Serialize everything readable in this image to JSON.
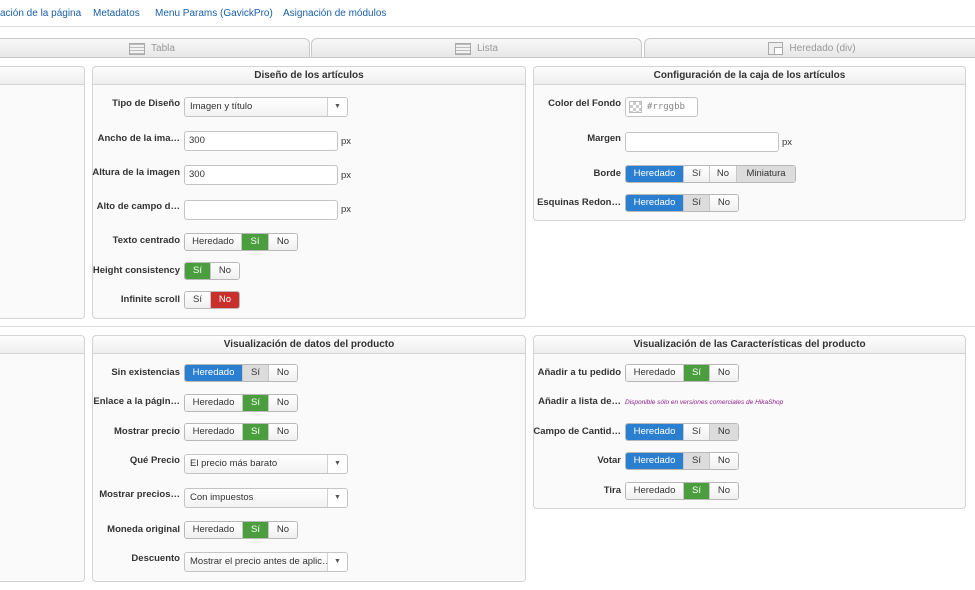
{
  "nav": {
    "links": [
      "ación de la página",
      "Metadatos",
      "Menu Params (GavickPro)",
      "Asignación de módulos"
    ]
  },
  "view_tabs": [
    "Tabla",
    "Lista",
    "Heredado (div)"
  ],
  "article_layout": {
    "title": "Diseño de los artículos",
    "layout_type": {
      "label": "Tipo de Diseño",
      "value": "Imagen y título"
    },
    "image_width": {
      "label": "Ancho de la ima…",
      "value": "300",
      "unit": "px"
    },
    "image_height": {
      "label": "Altura de la imagen",
      "value": "300",
      "unit": "px"
    },
    "field_height": {
      "label": "Alto de campo d…",
      "value": "",
      "unit": "px"
    },
    "center_text": {
      "label": "Texto centrado",
      "options": [
        "Heredado",
        "Sí",
        "No"
      ]
    },
    "height_consistency": {
      "label": "Height consistency",
      "options": [
        "Sí",
        "No"
      ]
    },
    "infinite_scroll": {
      "label": "Infinite scroll",
      "options": [
        "Sí",
        "No"
      ]
    }
  },
  "article_box": {
    "title": "Configuración de la caja de los artículos",
    "bg_color": {
      "label": "Color del Fondo",
      "placeholder": "#rrggbb"
    },
    "margin": {
      "label": "Margen",
      "value": "",
      "unit": "px"
    },
    "border": {
      "label": "Borde",
      "options": [
        "Heredado",
        "Sí",
        "No",
        "Miniatura"
      ]
    },
    "rounded": {
      "label": "Esquinas Redon…",
      "options": [
        "Heredado",
        "Sí",
        "No"
      ]
    }
  },
  "product_data": {
    "title": "Visualización de datos del producto",
    "out_of_stock": {
      "label": "Sin existencias",
      "options": [
        "Heredado",
        "Sí",
        "No"
      ]
    },
    "page_link": {
      "label": "Enlace a la págin…",
      "options": [
        "Heredado",
        "Sí",
        "No"
      ]
    },
    "show_price": {
      "label": "Mostrar precio",
      "options": [
        "Heredado",
        "Sí",
        "No"
      ]
    },
    "which_price": {
      "label": "Qué Precio",
      "value": "El precio más barato"
    },
    "show_prices_tax": {
      "label": "Mostrar precios…",
      "value": "Con impuestos"
    },
    "original_currency": {
      "label": "Moneda original",
      "options": [
        "Heredado",
        "Sí",
        "No"
      ]
    },
    "discount": {
      "label": "Descuento",
      "value": "Mostrar el precio antes de aplic…"
    }
  },
  "product_features": {
    "title": "Visualización de las Características del producto",
    "add_to_cart": {
      "label": "Añadir a tu pedido",
      "options": [
        "Heredado",
        "Sí",
        "No"
      ]
    },
    "add_to_list": {
      "label": "Añadir a lista de…",
      "note": "Disponible sólo en versiones comerciales de HikaShop"
    },
    "quantity_field": {
      "label": "Campo de Cantid…",
      "options": [
        "Heredado",
        "Sí",
        "No"
      ]
    },
    "vote": {
      "label": "Votar",
      "options": [
        "Heredado",
        "Sí",
        "No"
      ]
    },
    "strip": {
      "label": "Tira",
      "options": [
        "Heredado",
        "Sí",
        "No"
      ]
    }
  },
  "colors": {
    "active_blue": "#2b7fd1",
    "active_green": "#4a9e3d",
    "active_red": "#c9302c",
    "link": "#1a5fa8",
    "note_purple": "#8b1d8b"
  }
}
